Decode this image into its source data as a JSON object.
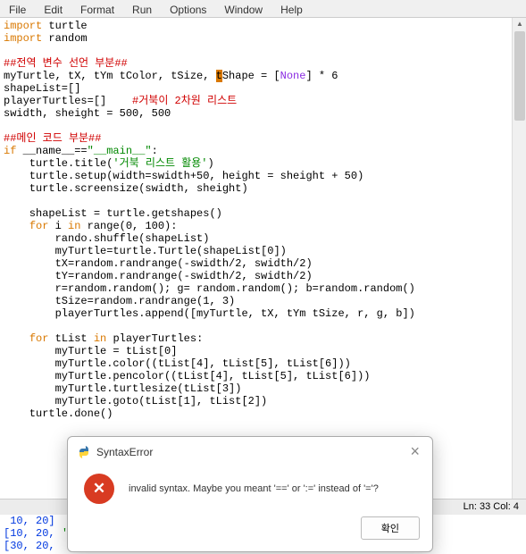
{
  "menu": {
    "items": [
      "File",
      "Edit",
      "Format",
      "Run",
      "Options",
      "Window",
      "Help"
    ]
  },
  "code": {
    "l1a": "import",
    "l1b": " turtle",
    "l2a": "import",
    "l2b": " random",
    "l4": "##전역 변수 선언 부분##",
    "l5a": "myTurtle, tX, tYm tColor, tSize, ",
    "l5hl": "t",
    "l5b": "Shape = [",
    "l5c": "None",
    "l5d": "] * 6",
    "l6": "shapeList=[]",
    "l7a": "playerTurtles=[]    ",
    "l7b": "#거북이 2차원 리스트",
    "l8": "swidth, sheight = 500, 500",
    "l10": "##메인 코드 부분##",
    "l11a": "if",
    "l11b": " __name__==",
    "l11c": "\"__main__\"",
    "l11d": ":",
    "l12a": "    turtle.title(",
    "l12b": "'거북 리스트 활용'",
    "l12c": ")",
    "l13": "    turtle.setup(width=swidth+50, height = sheight + 50)",
    "l14": "    turtle.screensize(swidth, sheight)",
    "l16": "    shapeList = turtle.getshapes()",
    "l17a": "    ",
    "l17b": "for",
    "l17c": " i ",
    "l17d": "in",
    "l17e": " range(0, 100):",
    "l18": "        rando.shuffle(shapeList)",
    "l19": "        myTurtle=turtle.Turtle(shapeList[0])",
    "l20": "        tX=random.randrange(-swidth/2, swidth/2)",
    "l21": "        tY=random.randrange(-swidth/2, swidth/2)",
    "l22": "        r=random.random(); g= random.random(); b=random.random()",
    "l23": "        tSize=random.randrange(1, 3)",
    "l24": "        playerTurtles.append([myTurtle, tX, tYm tSize, r, g, b])",
    "l26a": "    ",
    "l26b": "for",
    "l26c": " tList ",
    "l26d": "in",
    "l26e": " playerTurtles:",
    "l27": "        myTurtle = tList[0]",
    "l28": "        myTurtle.color((tList[4], tList[5], tList[6]))",
    "l29": "        myTurtle.pencolor((tList[4], tList[5], tList[6]))",
    "l30": "        myTurtle.turtlesize(tList[3])",
    "l31": "        myTurtle.goto(tList[1], tList[2])",
    "l32": "    turtle.done()"
  },
  "status": {
    "text": "Ln: 33   Col: 4"
  },
  "shell": {
    "l1": " 10, 20]",
    "l2a": "[10, 20, ",
    "l2b": "'",
    "l2c": "~",
    "l3": "[30, 20, "
  },
  "dialog": {
    "title": "SyntaxError",
    "icon_name": "error-x-icon",
    "close": "×",
    "message": "invalid syntax. Maybe you meant '==' or ':=' instead of '='?",
    "ok": "확인"
  }
}
